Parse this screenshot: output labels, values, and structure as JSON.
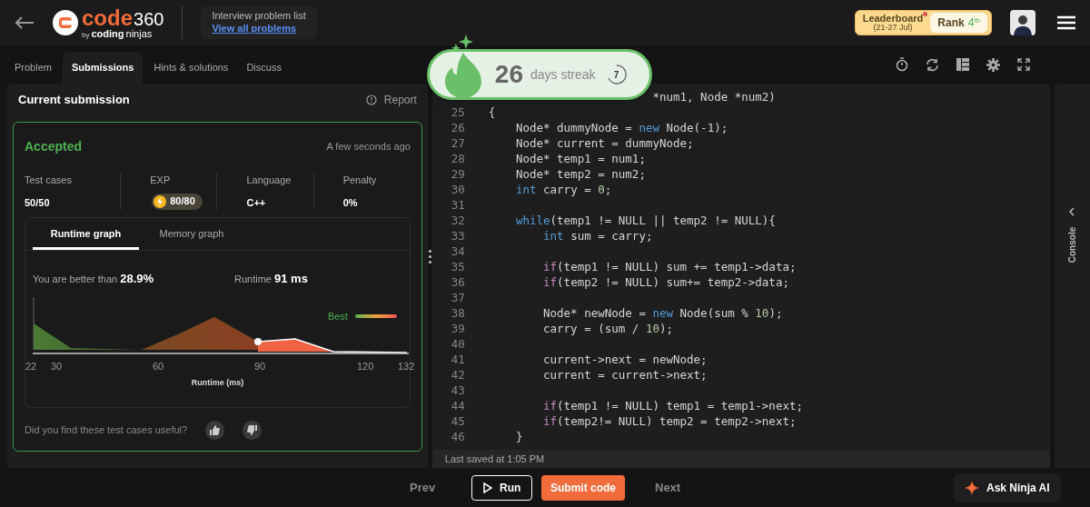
{
  "header": {
    "logo_main": "code",
    "logo_num": "360",
    "logo_sub_by": "by",
    "logo_sub_a": "coding",
    "logo_sub_b": "ninjas",
    "problem_list_title": "Interview problem list",
    "problem_list_link": "View all problems",
    "leaderboard": {
      "label": "Leaderboard",
      "dates": "(21-27 Jul)",
      "rank_label": "Rank",
      "rank": "4",
      "rank_suffix": "th",
      "notification": true
    }
  },
  "tabs": [
    {
      "label": "Problem",
      "selected": false
    },
    {
      "label": "Submissions",
      "selected": true
    },
    {
      "label": "Hints & solutions",
      "selected": false
    },
    {
      "label": "Discuss",
      "selected": false
    }
  ],
  "submission": {
    "title": "Current submission",
    "report": "Report",
    "status": "Accepted",
    "time": "A few seconds ago",
    "stats": [
      {
        "label": "Test cases",
        "value": "50/50",
        "kind": "plain"
      },
      {
        "label": "EXP",
        "value": "80/80",
        "kind": "exp"
      },
      {
        "label": "Language",
        "value": "C++",
        "kind": "plain"
      },
      {
        "label": "Penalty",
        "value": "0%",
        "kind": "plain"
      }
    ],
    "graph_tabs": [
      {
        "label": "Runtime graph",
        "selected": true
      },
      {
        "label": "Memory graph",
        "selected": false
      }
    ],
    "better_label": "You are better than",
    "better_value": "28.9%",
    "runtime_label": "Runtime",
    "runtime_value": "91 ms",
    "legend": "Best",
    "axis_ticks": [
      "22",
      "30",
      "60",
      "90",
      "120",
      "132"
    ],
    "xlabel": "Runtime (ms)",
    "feedback": "Did you find these test cases useful?"
  },
  "streak": {
    "days": "26",
    "label": "days streak",
    "ring": "7"
  },
  "code_lines": [
    {
      "tokens": [
        {
          "kind": "plain",
          "text": "                        *num1, Node *num2)"
        }
      ]
    },
    {
      "num": "25",
      "tokens": [
        {
          "kind": "plain",
          "text": "{"
        }
      ]
    },
    {
      "num": "26",
      "tokens": [
        {
          "kind": "plain",
          "text": "    Node* dummyNode = "
        },
        {
          "kind": "keyword",
          "text": "new"
        },
        {
          "kind": "plain",
          "text": " Node(-1);"
        }
      ]
    },
    {
      "num": "27",
      "tokens": [
        {
          "kind": "plain",
          "text": "    Node* current = dummyNode;"
        }
      ]
    },
    {
      "num": "28",
      "tokens": [
        {
          "kind": "plain",
          "text": "    Node* temp1 = num1;"
        }
      ]
    },
    {
      "num": "29",
      "tokens": [
        {
          "kind": "plain",
          "text": "    Node* temp2 = num2;"
        }
      ]
    },
    {
      "num": "30",
      "tokens": [
        {
          "kind": "keyword",
          "text": "    int"
        },
        {
          "kind": "plain",
          "text": " carry = "
        },
        {
          "kind": "number",
          "text": "0"
        },
        {
          "kind": "plain",
          "text": ";"
        }
      ]
    },
    {
      "num": "31"
    },
    {
      "num": "32",
      "tokens": [
        {
          "kind": "keyword",
          "text": "    while"
        },
        {
          "kind": "plain",
          "text": "(temp1 != NULL || temp2 != NULL){"
        }
      ]
    },
    {
      "num": "33",
      "tokens": [
        {
          "kind": "keyword",
          "text": "        int"
        },
        {
          "kind": "plain",
          "text": " sum = carry;"
        }
      ]
    },
    {
      "num": "34"
    },
    {
      "num": "35",
      "tokens": [
        {
          "kind": "control",
          "text": "        if"
        },
        {
          "kind": "plain",
          "text": "(temp1 != NULL) sum += temp1->data;"
        }
      ]
    },
    {
      "num": "36",
      "tokens": [
        {
          "kind": "control",
          "text": "        if"
        },
        {
          "kind": "plain",
          "text": "(temp2 != NULL) sum+= temp2->data;"
        }
      ]
    },
    {
      "num": "37"
    },
    {
      "num": "38",
      "tokens": [
        {
          "kind": "plain",
          "text": "        Node* newNode = "
        },
        {
          "kind": "keyword",
          "text": "new"
        },
        {
          "kind": "plain",
          "text": " Node(sum % "
        },
        {
          "kind": "number",
          "text": "10"
        },
        {
          "kind": "plain",
          "text": ");"
        }
      ]
    },
    {
      "num": "39",
      "tokens": [
        {
          "kind": "plain",
          "text": "        carry = (sum / "
        },
        {
          "kind": "number",
          "text": "10"
        },
        {
          "kind": "plain",
          "text": ");"
        }
      ]
    },
    {
      "num": "40"
    },
    {
      "num": "41",
      "tokens": [
        {
          "kind": "plain",
          "text": "        current->next = newNode;"
        }
      ]
    },
    {
      "num": "42",
      "tokens": [
        {
          "kind": "plain",
          "text": "        current = current->next;"
        }
      ]
    },
    {
      "num": "43"
    },
    {
      "num": "44",
      "tokens": [
        {
          "kind": "control",
          "text": "        if"
        },
        {
          "kind": "plain",
          "text": "(temp1 != NULL) temp1 = temp1->next;"
        }
      ]
    },
    {
      "num": "45",
      "tokens": [
        {
          "kind": "control",
          "text": "        if"
        },
        {
          "kind": "plain",
          "text": "(temp2!= NULL) temp2 = temp2->next;"
        }
      ]
    },
    {
      "num": "46",
      "tokens": [
        {
          "kind": "plain",
          "text": "    }"
        }
      ]
    }
  ],
  "last_saved": "Last saved at 1:05 PM",
  "console": "Console",
  "footer": {
    "prev": "Prev",
    "run": "Run",
    "submit": "Submit code",
    "next": "Next",
    "ask": "Ask Ninja AI"
  }
}
